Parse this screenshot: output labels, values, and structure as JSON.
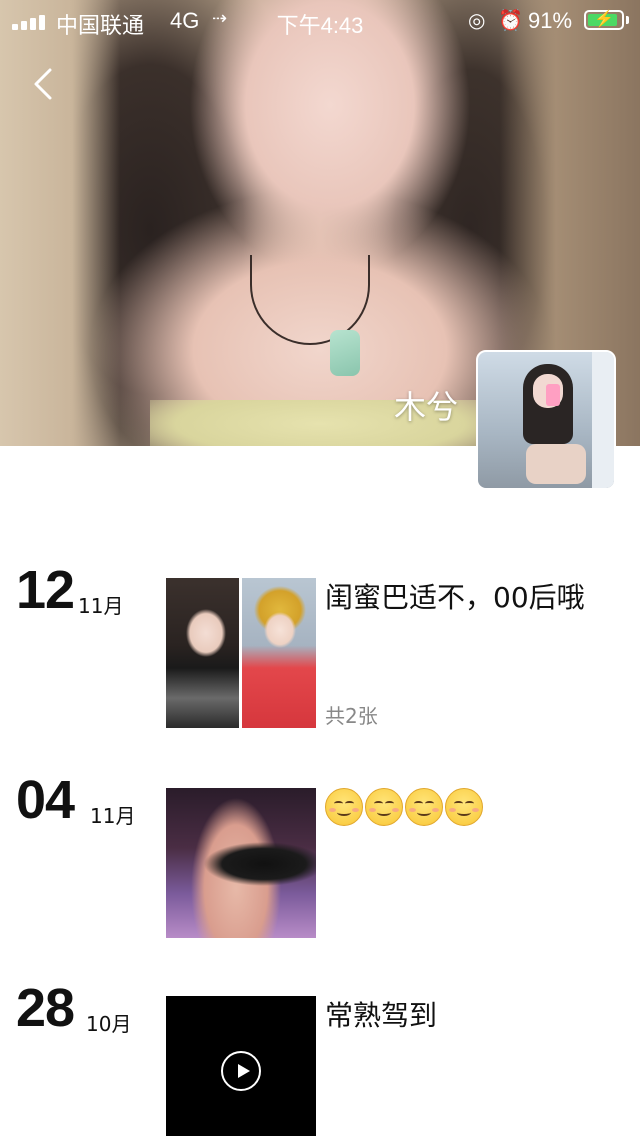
{
  "status_bar": {
    "carrier": "中国联通",
    "network": "4G",
    "time": "下午4:43",
    "battery_percent": "91%",
    "battery_level": 0.91
  },
  "profile": {
    "name": "木兮"
  },
  "posts": [
    {
      "day": "12",
      "month": "11月",
      "caption": "闺蜜巴适不，00后哦",
      "photo_count": "共2张",
      "media_type": "photos"
    },
    {
      "day": "04",
      "month": "11月",
      "caption": "",
      "emoji_count": 4,
      "media_type": "photo"
    },
    {
      "day": "28",
      "month": "10月",
      "caption": "常熟驾到",
      "media_type": "video"
    }
  ],
  "icons": {
    "back": "chevron-left-icon",
    "play": "play-icon",
    "emoji": "smiling-face-icon"
  }
}
